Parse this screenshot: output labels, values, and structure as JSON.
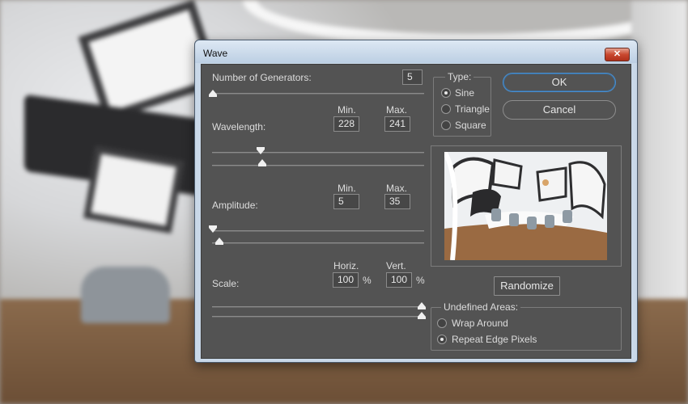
{
  "window": {
    "title": "Wave",
    "close_glyph": "✕"
  },
  "generators": {
    "label": "Number of Generators:",
    "value": "5"
  },
  "wavelength": {
    "label": "Wavelength:",
    "min_label": "Min.",
    "max_label": "Max.",
    "min": "228",
    "max": "241",
    "min_fraction": 0.23,
    "max_fraction": 0.24
  },
  "amplitude": {
    "label": "Amplitude:",
    "min_label": "Min.",
    "max_label": "Max.",
    "min": "5",
    "max": "35",
    "min_fraction": 0.0,
    "max_fraction": 0.035
  },
  "scale": {
    "label": "Scale:",
    "horiz_label": "Horiz.",
    "vert_label": "Vert.",
    "horiz": "100",
    "vert": "100",
    "percent": "%",
    "horiz_fraction": 1.0,
    "vert_fraction": 1.0
  },
  "type": {
    "title": "Type:",
    "options": [
      "Sine",
      "Triangle",
      "Square"
    ],
    "selected": "Sine"
  },
  "buttons": {
    "ok": "OK",
    "cancel": "Cancel",
    "randomize": "Randomize"
  },
  "undefined_areas": {
    "title": "Undefined Areas:",
    "options": [
      "Wrap Around",
      "Repeat Edge Pixels"
    ],
    "selected": "Repeat Edge Pixels"
  },
  "colors": {
    "panel": "#535353",
    "accent": "#4a8fd0",
    "close": "#c9482f"
  }
}
